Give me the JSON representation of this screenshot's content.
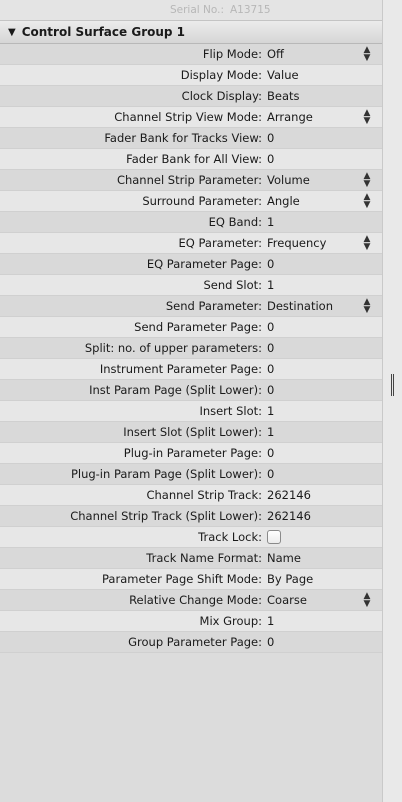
{
  "top_strip": {
    "label": "Serial No.:",
    "value": "A13715"
  },
  "group": {
    "toggle_icon": "triangle-down",
    "title": "Control Surface Group 1"
  },
  "rows": [
    {
      "label": "Flip Mode:",
      "value": "Off",
      "stepper": true
    },
    {
      "label": "Display Mode:",
      "value": "Value"
    },
    {
      "label": "Clock Display:",
      "value": "Beats"
    },
    {
      "label": "Channel Strip View Mode:",
      "value": "Arrange",
      "stepper": true
    },
    {
      "label": "Fader Bank for Tracks View:",
      "value": "0"
    },
    {
      "label": "Fader Bank for All View:",
      "value": "0"
    },
    {
      "label": "Channel Strip Parameter:",
      "value": "Volume",
      "stepper": true
    },
    {
      "label": "Surround Parameter:",
      "value": "Angle",
      "stepper": true
    },
    {
      "label": "EQ Band:",
      "value": "1"
    },
    {
      "label": "EQ Parameter:",
      "value": "Frequency",
      "stepper": true
    },
    {
      "label": "EQ Parameter Page:",
      "value": "0"
    },
    {
      "label": "Send Slot:",
      "value": "1"
    },
    {
      "label": "Send Parameter:",
      "value": "Destination",
      "stepper": true
    },
    {
      "label": "Send Parameter Page:",
      "value": "0"
    },
    {
      "label": "Split: no. of upper parameters:",
      "value": "0"
    },
    {
      "label": "Instrument Parameter Page:",
      "value": "0"
    },
    {
      "label": "Inst Param Page (Split Lower):",
      "value": "0"
    },
    {
      "label": "Insert Slot:",
      "value": "1"
    },
    {
      "label": "Insert Slot (Split Lower):",
      "value": "1"
    },
    {
      "label": "Plug-in Parameter Page:",
      "value": "0"
    },
    {
      "label": "Plug-in Param Page (Split Lower):",
      "value": "0"
    },
    {
      "label": "Channel Strip Track:",
      "value": "262146"
    },
    {
      "label": "Channel Strip Track (Split Lower):",
      "value": "262146"
    },
    {
      "label": "Track Lock:",
      "value": "",
      "checkbox": true,
      "checked": false
    },
    {
      "label": "Track Name Format:",
      "value": "Name"
    },
    {
      "label": "Parameter Page Shift Mode:",
      "value": "By Page"
    },
    {
      "label": "Relative Change Mode:",
      "value": "Coarse",
      "stepper": true
    },
    {
      "label": "Mix Group:",
      "value": "1"
    },
    {
      "label": "Group Parameter Page:",
      "value": "0"
    }
  ]
}
